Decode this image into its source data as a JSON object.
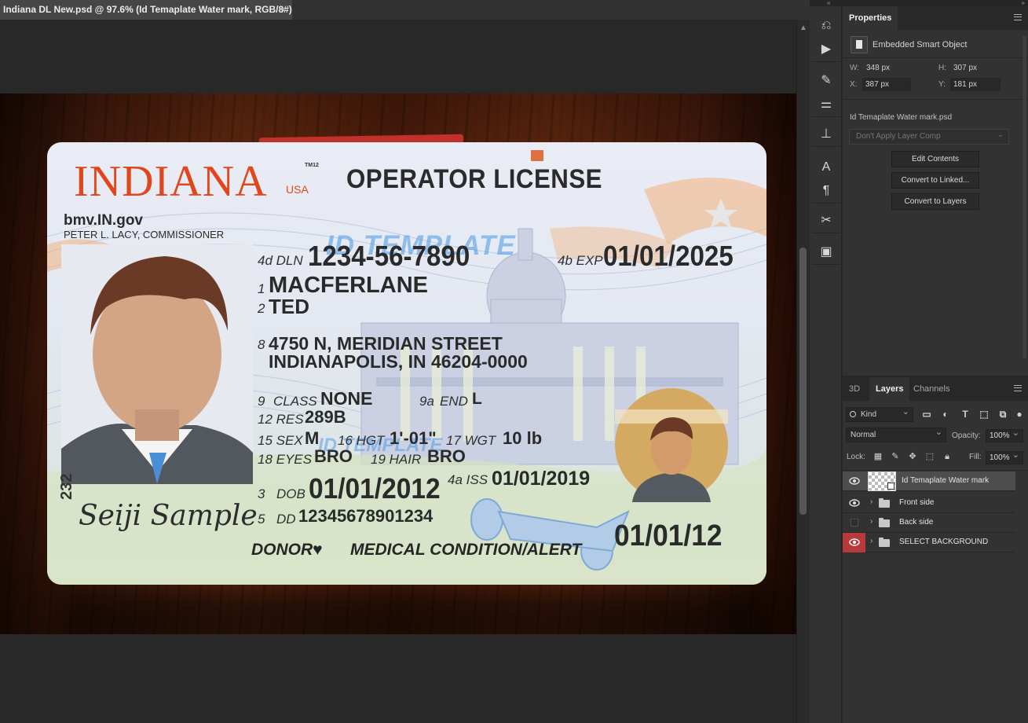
{
  "document_tab": {
    "title": "Indiana DL New.psd @ 97.6% (Id Temaplate Water mark, RGB/8#) *",
    "close": "×"
  },
  "card": {
    "state": "INDIANA",
    "country": "USA",
    "tm": "TM12",
    "doc_type": "OPERATOR LICENSE",
    "website": "bmv.IN.gov",
    "commissioner": "PETER L. LACY, COMMISSIONER",
    "dln_label": "4d DLN",
    "dln": "1234-56-7890",
    "exp_label": "4b EXP",
    "exp": "01/01/2025",
    "f1": "1",
    "last_name": "MACFERLANE",
    "f2": "2",
    "first_name": "TED",
    "f8": "8",
    "address1": "4750 N, MERIDIAN STREET",
    "address2": "INDIANAPOLIS, IN 46204-0000",
    "f9": "9",
    "class_label": "CLASS",
    "class": "NONE",
    "f9a": "9a",
    "end_label": "END",
    "end": "L",
    "res_label": "12 RES",
    "res": "289B",
    "sex_label": "15 SEX",
    "sex": "M",
    "hgt_label": "16 HGT",
    "hgt": "1'-01\"",
    "wgt_label": "17 WGT",
    "wgt": "10 lb",
    "eyes_label": "18 EYES",
    "eyes": "BRO",
    "hair_label": "19 HAIR",
    "hair": "BRO",
    "f3": "3",
    "dob_label": "DOB",
    "dob": "01/01/2012",
    "iss_label": "4a ISS",
    "iss": "01/01/2019",
    "f5": "5",
    "dd_label": "DD",
    "dd": "12345678901234",
    "donor": "DONOR♥",
    "medical": "MEDICAL CONDITION/ALERT",
    "date_small": "01/01/12",
    "side_number": "232",
    "signature": "Seiji Sample",
    "watermark": "ID TEMPLATE"
  },
  "properties": {
    "tab": "Properties",
    "object_type": "Embedded Smart Object",
    "w_label": "W:",
    "w": "348 px",
    "h_label": "H:",
    "h": "307 px",
    "x_label": "X:",
    "x": "387 px",
    "y_label": "Y:",
    "y": "181 px",
    "linked_file": "Id Temaplate Water mark.psd",
    "layer_comp": "Don't Apply Layer Comp",
    "buttons": [
      "Edit Contents",
      "Convert to Linked...",
      "Convert to Layers"
    ]
  },
  "layers_panel": {
    "tabs": [
      "3D",
      "Layers",
      "Channels"
    ],
    "filter_kind": "Kind",
    "blend_mode": "Normal",
    "opacity_label": "Opacity:",
    "opacity": "100%",
    "lock_label": "Lock:",
    "fill_label": "Fill:",
    "fill": "100%",
    "layers": [
      {
        "name": "Id Temaplate Water mark",
        "visible": true,
        "selected": true,
        "type": "smart-object"
      },
      {
        "name": "Front side",
        "visible": true,
        "type": "group"
      },
      {
        "name": "Back side",
        "visible": false,
        "type": "group"
      },
      {
        "name": "SELECT BACKGROUND",
        "visible": true,
        "type": "group"
      }
    ]
  },
  "colors": {
    "accent_red": "#b8393a",
    "indiana_orange": "#e0471c",
    "panel_bg": "#323232"
  }
}
